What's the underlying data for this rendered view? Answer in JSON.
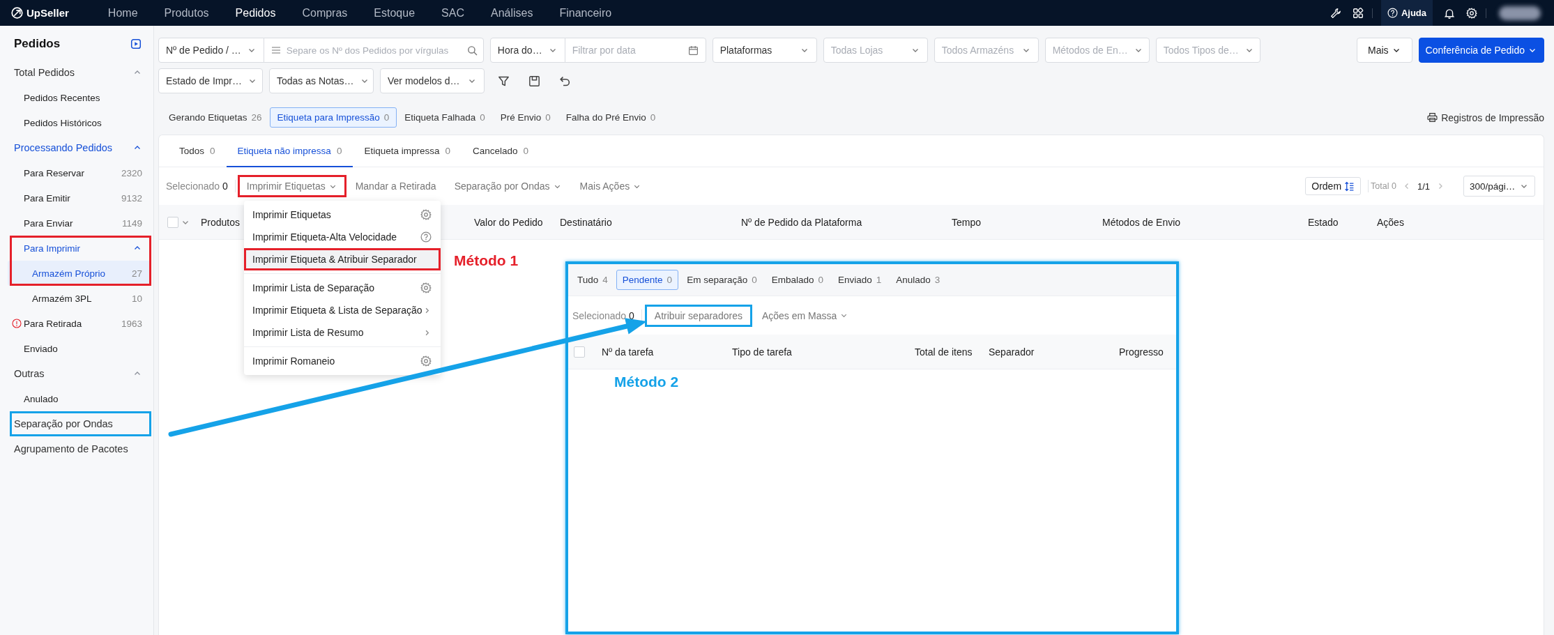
{
  "topbar": {
    "brand": "UpSeller",
    "nav": [
      {
        "label": "Home",
        "selected": false
      },
      {
        "label": "Produtos",
        "selected": false
      },
      {
        "label": "Pedidos",
        "selected": true
      },
      {
        "label": "Compras",
        "selected": false
      },
      {
        "label": "Estoque",
        "selected": false
      },
      {
        "label": "SAC",
        "selected": false
      },
      {
        "label": "Análises",
        "selected": false
      },
      {
        "label": "Financeiro",
        "selected": false
      }
    ],
    "help": "Ajuda"
  },
  "sidebar": {
    "title": "Pedidos",
    "items": [
      {
        "label": "Total Pedidos",
        "expanded": true,
        "selected": false,
        "children": [
          {
            "label": "Pedidos Recentes",
            "selected": false
          },
          {
            "label": "Pedidos Históricos",
            "selected": false
          }
        ]
      },
      {
        "label": "Processando Pedidos",
        "expanded": true,
        "selected": false,
        "children": [
          {
            "label": "Para Reservar",
            "count": "2320",
            "alert": false,
            "selected": false
          },
          {
            "label": "Para Emitir",
            "count": "9132",
            "alert": false,
            "selected": false
          },
          {
            "label": "Para Enviar",
            "count": "1149",
            "alert": false,
            "selected": false
          },
          {
            "label": "Para Imprimir",
            "alert": false,
            "expanded": true,
            "selected": false,
            "color": "#e5202a",
            "children": [
              {
                "label": "Armazém Próprio",
                "count": "27",
                "selected": true,
                "color": "#e5202a"
              },
              {
                "label": "Armazém 3PL",
                "count": "10",
                "selected": false
              }
            ]
          },
          {
            "label": "Para Retirada",
            "count": "1963",
            "alert": true,
            "selected": false
          },
          {
            "label": "Enviado",
            "alert": false,
            "selected": false
          }
        ]
      },
      {
        "label": "Outras",
        "expanded": true,
        "selected": false,
        "children": [
          {
            "label": "Anulado",
            "selected": false
          }
        ]
      },
      {
        "label": "Separação por Ondas",
        "selected": false,
        "color": "#15a2e8"
      },
      {
        "label": "Agrupamento de Pacotes",
        "selected": false
      }
    ]
  },
  "filters": {
    "main_row": [
      {
        "kind": "select",
        "value": "Nº de Pedido / …"
      },
      {
        "kind": "search",
        "placeholder": "Separe os Nº dos Pedidos por vírgulas"
      },
      {
        "kind": "select",
        "value": "Hora do…"
      },
      {
        "kind": "date",
        "placeholder": "Filtrar por data"
      },
      {
        "kind": "select",
        "value": "Plataformas"
      },
      {
        "kind": "select",
        "placeholder": "Todas Lojas"
      },
      {
        "kind": "select",
        "placeholder": "Todos Armazéns"
      },
      {
        "kind": "select",
        "placeholder": "Métodos de En…"
      },
      {
        "kind": "select",
        "placeholder": "Todos Tipos de…"
      }
    ],
    "extra_row": [
      {
        "kind": "select",
        "value": "Estado de Impr…"
      },
      {
        "kind": "select",
        "value": "Todas as Notas…"
      },
      {
        "kind": "select",
        "value": "Ver modelos d…"
      }
    ],
    "more": "Mais",
    "primary": "Conferência de Pedido"
  },
  "status_tabs": [
    {
      "label": "Gerando Etiquetas",
      "count": "26",
      "selected": false
    },
    {
      "label": "Etiqueta para Impressão",
      "count": "0",
      "selected": true
    },
    {
      "label": "Etiqueta Falhada",
      "count": "0",
      "selected": false
    },
    {
      "label": "Pré Envio",
      "count": "0",
      "selected": false
    },
    {
      "label": "Falha do Pré Envio",
      "count": "0",
      "selected": false
    }
  ],
  "print_log": "Registros de Impressão",
  "card": {
    "tabs": [
      {
        "label": "Todos",
        "count": "0",
        "selected": false
      },
      {
        "label": "Etiqueta não impressa",
        "count": "0",
        "selected": true
      },
      {
        "label": "Etiqueta impressa",
        "count": "0",
        "selected": false
      },
      {
        "label": "Cancelado",
        "count": "0",
        "selected": false
      }
    ],
    "selection": {
      "label": "Selecionado",
      "count": "0"
    },
    "actions": [
      {
        "label": "Imprimir Etiquetas",
        "dropdown": true,
        "color": "#e5202a"
      },
      {
        "label": "Mandar a Retirada",
        "dropdown": false
      },
      {
        "label": "Separação por Ondas",
        "dropdown": true
      },
      {
        "label": "Mais Ações",
        "dropdown": true
      }
    ],
    "sort": "Ordem",
    "total": "Total 0",
    "page": "1/1",
    "page_size": "300/pági…",
    "select_all": {
      "checked": false
    },
    "columns": [
      "Produtos",
      "Valor do Pedido",
      "Destinatário",
      "Nº de Pedido da Plataforma",
      "Tempo",
      "Métodos de Envio",
      "Estado",
      "Ações"
    ]
  },
  "menu": {
    "groups": [
      [
        {
          "label": "Imprimir Etiquetas",
          "kind": "settings",
          "hovered": false
        },
        {
          "label": "Imprimir Etiqueta-Alta Velocidade",
          "kind": "help",
          "hovered": false
        },
        {
          "label": "Imprimir Etiqueta & Atribuir Separador",
          "kind": "plain",
          "hovered": true,
          "color": "#e5202a"
        }
      ],
      [
        {
          "label": "Imprimir Lista de Separação",
          "kind": "settings",
          "hovered": false
        },
        {
          "label": "Imprimir Etiqueta & Lista de Separação",
          "kind": "submenu",
          "hovered": false
        },
        {
          "label": "Imprimir Lista de Resumo",
          "kind": "submenu",
          "hovered": false
        }
      ],
      [
        {
          "label": "Imprimir Romaneio",
          "kind": "settings",
          "hovered": false
        }
      ]
    ],
    "annotation": {
      "label": "Método 1",
      "color": "#e5202a"
    }
  },
  "inset": {
    "tabs": [
      {
        "label": "Tudo",
        "count": "4",
        "selected": false
      },
      {
        "label": "Pendente",
        "count": "0",
        "selected": true
      },
      {
        "label": "Em separação",
        "count": "0",
        "selected": false
      },
      {
        "label": "Embalado",
        "count": "0",
        "selected": false
      },
      {
        "label": "Enviado",
        "count": "1",
        "selected": false
      },
      {
        "label": "Anulado",
        "count": "3",
        "selected": false
      }
    ],
    "selection": {
      "label": "Selecionado",
      "count": "0"
    },
    "actions": [
      {
        "label": "Atribuir separadores",
        "dropdown": false,
        "color": "#15a2e8"
      },
      {
        "label": "Ações em Massa",
        "dropdown": true
      }
    ],
    "select_all": {
      "checked": false
    },
    "columns": [
      "Nº da tarefa",
      "Tipo de tarefa",
      "Total de itens",
      "Separador",
      "Progresso"
    ],
    "annotation": {
      "label": "Método 2",
      "color": "#15a2e8"
    }
  }
}
